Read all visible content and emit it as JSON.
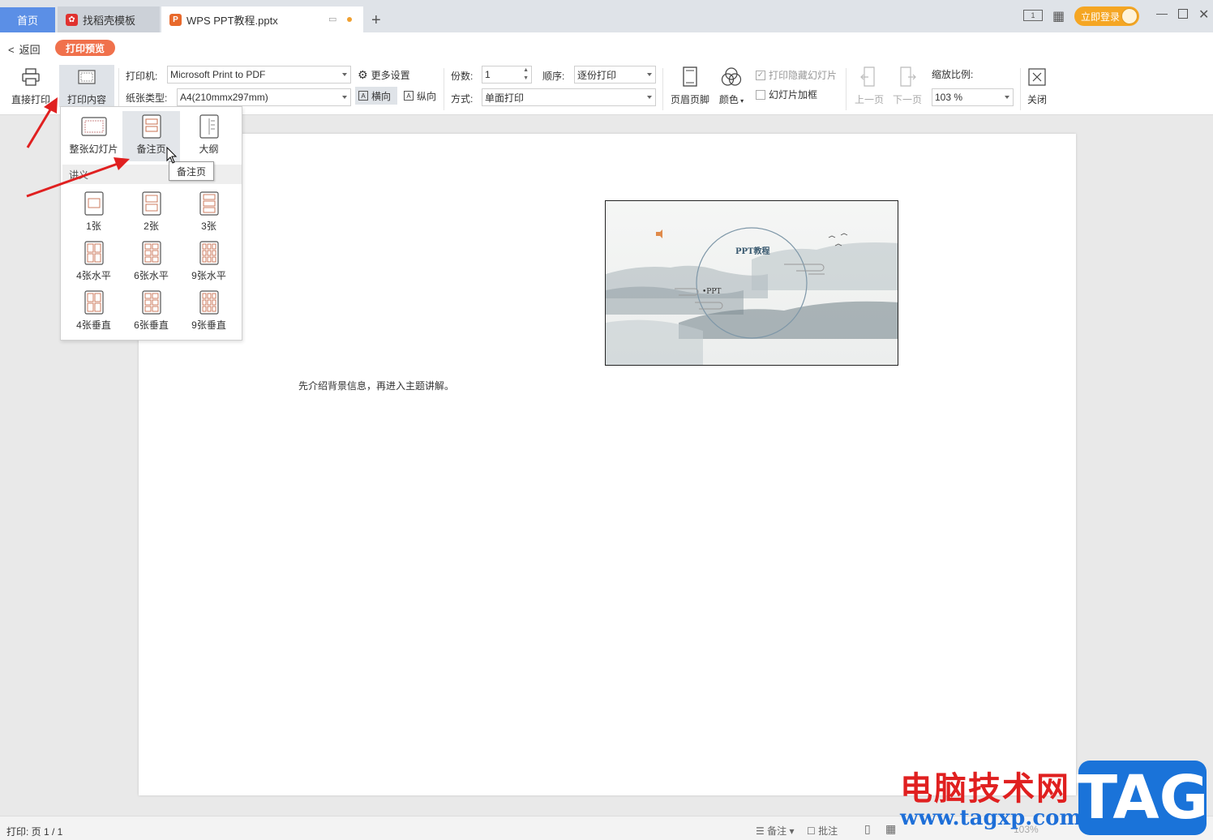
{
  "titlebar": {
    "tabs": [
      {
        "label": "首页"
      },
      {
        "label": "找稻壳模板"
      },
      {
        "label": "WPS PPT教程.pptx"
      }
    ],
    "login_label": "立即登录"
  },
  "backbar": {
    "back_label": "返回",
    "badge": "打印预览"
  },
  "toolbar": {
    "direct_print": "直接打印",
    "print_content": "打印内容",
    "printer_label": "打印机:",
    "printer_value": "Microsoft Print to PDF",
    "more_settings": "更多设置",
    "paper_label": "纸张类型:",
    "paper_value": "A4(210mmx297mm)",
    "landscape": "横向",
    "portrait": "纵向",
    "copies_label": "份数:",
    "copies_value": "1",
    "order_label": "顺序:",
    "order_value": "逐份打印",
    "mode_label": "方式:",
    "mode_value": "单面打印",
    "header_footer": "页眉页脚",
    "color": "颜色",
    "print_hidden": "打印隐藏幻灯片",
    "slide_frame": "幻灯片加框",
    "prev_page": "上一页",
    "next_page": "下一页",
    "zoom_label": "缩放比例:",
    "zoom_value": "103 %",
    "close": "关闭"
  },
  "dropdown": {
    "top_items": [
      {
        "label": "整张幻灯片"
      },
      {
        "label": "备注页"
      },
      {
        "label": "大纲"
      }
    ],
    "section": "讲义",
    "handouts": [
      {
        "label": "1张"
      },
      {
        "label": "2张"
      },
      {
        "label": "3张"
      },
      {
        "label": "4张水平"
      },
      {
        "label": "6张水平"
      },
      {
        "label": "9张水平"
      },
      {
        "label": "4张垂直"
      },
      {
        "label": "6张垂直"
      },
      {
        "label": "9张垂直"
      }
    ],
    "tooltip": "备注页"
  },
  "page": {
    "slide_title": "PPT教程",
    "slide_bullet": "•PPT",
    "notes_text": "先介绍背景信息，再进入主题讲解。"
  },
  "statusbar": {
    "print_status": "打印: 页 1 / 1",
    "notes": "备注",
    "comments": "批注",
    "zoom": "103%"
  },
  "watermark": {
    "cn": "电脑技术网",
    "url": "www.tagxp.com",
    "tag": "TAG"
  },
  "colors": {
    "accent": "#f0714c",
    "home_tab": "#5b8fe6",
    "login": "#f5a623",
    "arrow": "#e02020"
  }
}
